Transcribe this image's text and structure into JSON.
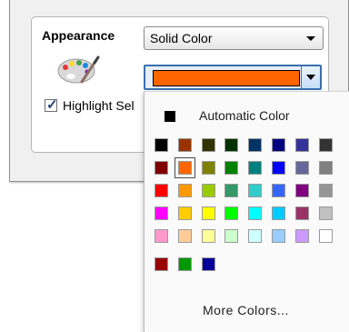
{
  "appearance_label": "Appearance",
  "appearance_select": {
    "value": "Solid Color"
  },
  "color_select": {
    "value_color": "#ff6600"
  },
  "highlight_checkbox": {
    "label": "Highlight Sel",
    "checked": true
  },
  "palette_icon": "paint-palette-icon",
  "color_popup": {
    "automatic_label": "Automatic Color",
    "automatic_color": "#000000",
    "more_colors_label": "More Colors...",
    "selected_color": "#ff6600",
    "rows": [
      [
        "#000000",
        "#993300",
        "#333300",
        "#003300",
        "#003366",
        "#000080",
        "#333399",
        "#333333"
      ],
      [
        "#800000",
        "#ff6600",
        "#808000",
        "#008000",
        "#008080",
        "#0000ff",
        "#666699",
        "#808080"
      ],
      [
        "#ff0000",
        "#ff9900",
        "#99cc00",
        "#339966",
        "#33cccc",
        "#3366ff",
        "#800080",
        "#969696"
      ],
      [
        "#ff00ff",
        "#ffcc00",
        "#ffff00",
        "#00ff00",
        "#00ffff",
        "#00ccff",
        "#993366",
        "#c0c0c0"
      ],
      [
        "#ff99cc",
        "#ffcc99",
        "#ffff99",
        "#ccffcc",
        "#ccffff",
        "#99ccff",
        "#cc99ff",
        "#ffffff"
      ],
      [
        "#990000",
        "#009900",
        "#000099"
      ]
    ]
  }
}
